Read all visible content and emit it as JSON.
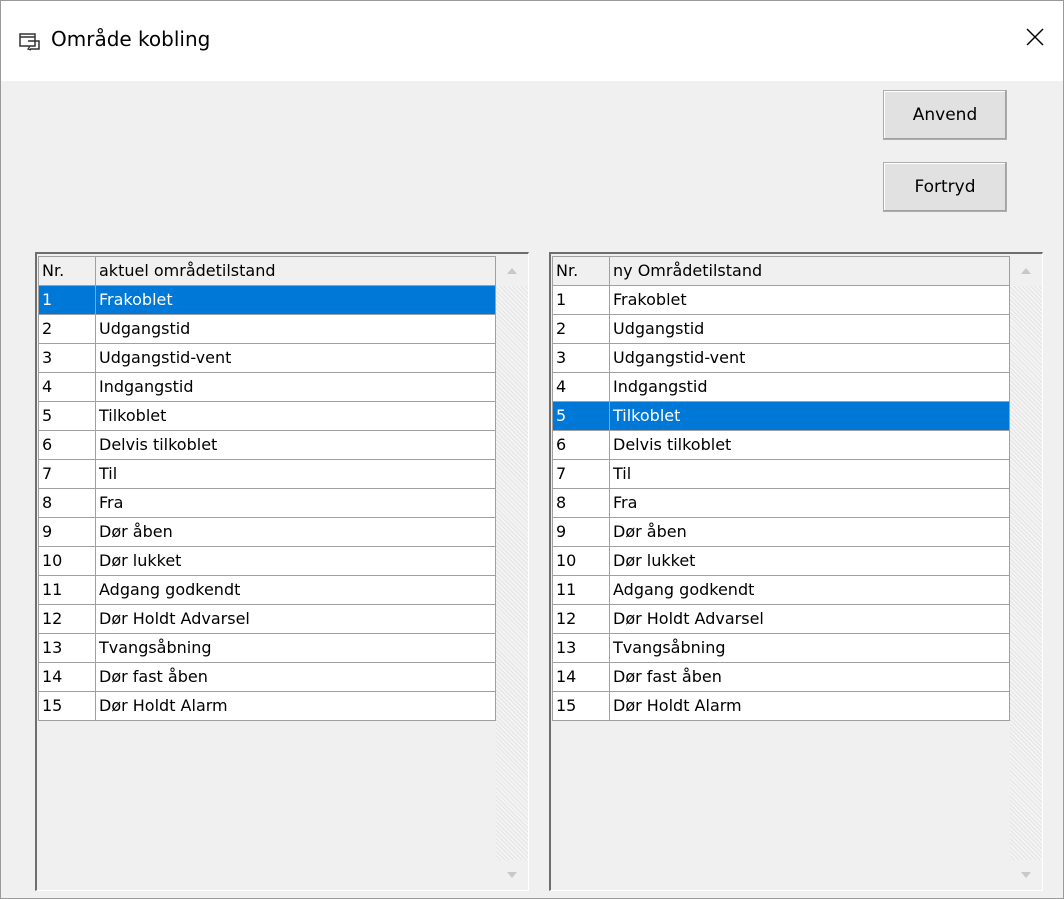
{
  "window": {
    "title": "Område kobling",
    "icon": "area-link-icon",
    "close_icon": "close-icon"
  },
  "buttons": {
    "apply": "Anvend",
    "cancel": "Fortryd"
  },
  "left_grid": {
    "headers": [
      "Nr.",
      "aktuel områdetilstand"
    ],
    "selected_index": 0,
    "rows": [
      [
        "1",
        "Frakoblet"
      ],
      [
        "2",
        "Udgangstid"
      ],
      [
        "3",
        "Udgangstid-vent"
      ],
      [
        "4",
        "Indgangstid"
      ],
      [
        "5",
        "Tilkoblet"
      ],
      [
        "6",
        "Delvis tilkoblet"
      ],
      [
        "7",
        "Til"
      ],
      [
        "8",
        "Fra"
      ],
      [
        "9",
        "Dør åben"
      ],
      [
        "10",
        "Dør lukket"
      ],
      [
        "11",
        "Adgang godkendt"
      ],
      [
        "12",
        "Dør Holdt Advarsel"
      ],
      [
        "13",
        "Tvangsåbning"
      ],
      [
        "14",
        "Dør fast åben"
      ],
      [
        "15",
        "Dør Holdt Alarm"
      ]
    ]
  },
  "right_grid": {
    "headers": [
      "Nr.",
      "ny Områdetilstand"
    ],
    "selected_index": 4,
    "rows": [
      [
        "1",
        "Frakoblet"
      ],
      [
        "2",
        "Udgangstid"
      ],
      [
        "3",
        "Udgangstid-vent"
      ],
      [
        "4",
        "Indgangstid"
      ],
      [
        "5",
        "Tilkoblet"
      ],
      [
        "6",
        "Delvis tilkoblet"
      ],
      [
        "7",
        "Til"
      ],
      [
        "8",
        "Fra"
      ],
      [
        "9",
        "Dør åben"
      ],
      [
        "10",
        "Dør lukket"
      ],
      [
        "11",
        "Adgang godkendt"
      ],
      [
        "12",
        "Dør Holdt Advarsel"
      ],
      [
        "13",
        "Tvangsåbning"
      ],
      [
        "14",
        "Dør fast åben"
      ],
      [
        "15",
        "Dør Holdt Alarm"
      ]
    ]
  },
  "colors": {
    "selection": "#0078d7",
    "dialog_background": "#f0f0f0",
    "titlebar": "#ffffff"
  }
}
